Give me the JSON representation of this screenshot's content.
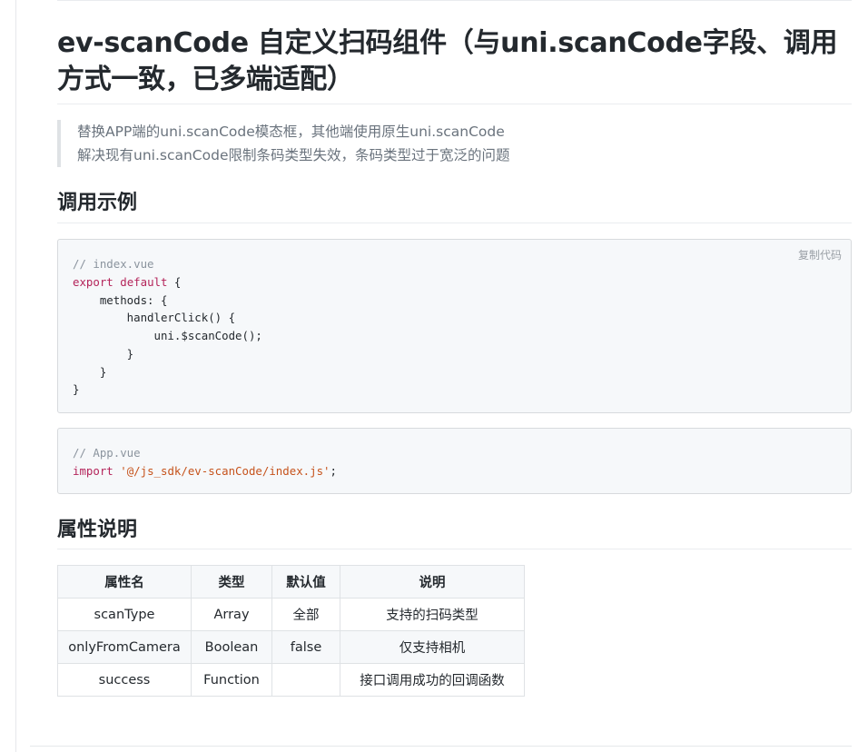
{
  "title": "ev-scanCode 自定义扫码组件（与uni.scanCode字段、调用方式一致，已多端适配）",
  "intro": {
    "lines": [
      "替换APP端的uni.scanCode模态框，其他端使用原生uni.scanCode",
      "解决现有uni.scanCode限制条码类型失效，条码类型过于宽泛的问题"
    ]
  },
  "usage": {
    "heading": "调用示例",
    "copy_label": "复制代码",
    "code1": {
      "comment": "// index.vue",
      "export_kw": "export",
      "default_kw": "default",
      "line1_rest": " {",
      "line2": "    methods: {",
      "line3": "        handlerClick() {",
      "line4": "            uni.$scanCode();",
      "line5": "        }",
      "line6": "    }",
      "line7": "}"
    },
    "code2": {
      "comment": "// App.vue",
      "import_kw": "import",
      "path": "'@/js_sdk/ev-scanCode/index.js'",
      "end": ";"
    }
  },
  "props": {
    "heading": "属性说明",
    "columns": [
      "属性名",
      "类型",
      "默认值",
      "说明"
    ],
    "rows": [
      [
        "scanType",
        "Array",
        "全部",
        "支持的扫码类型"
      ],
      [
        "onlyFromCamera",
        "Boolean",
        "false",
        "仅支持相机"
      ],
      [
        "success",
        "Function",
        "",
        "接口调用成功的回调函数"
      ]
    ]
  }
}
